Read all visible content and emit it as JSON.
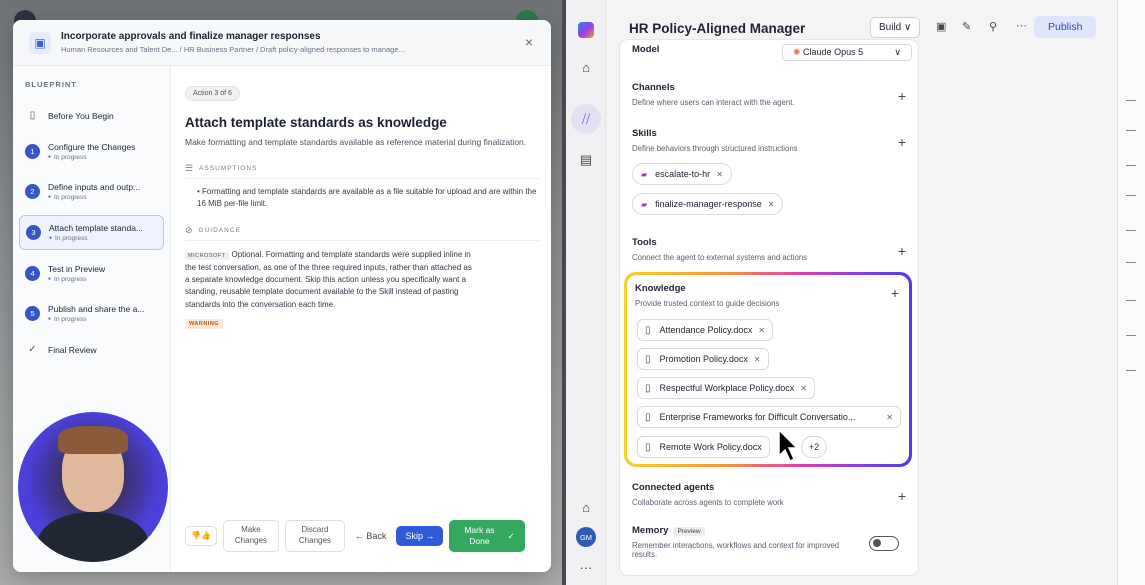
{
  "modal": {
    "title": "Incorporate approvals and finalize manager responses",
    "breadcrumb": "Human Resources and Talent De... / HR Business Partner / Draft policy-aligned responses to manage...",
    "close": "×"
  },
  "sidebar": {
    "label": "BLUEPRINT",
    "before": "Before You Begin",
    "steps": [
      {
        "num": "1",
        "title": "Configure the Changes",
        "status": "In progress"
      },
      {
        "num": "2",
        "title": "Define inputs and outp...",
        "status": "In progress"
      },
      {
        "num": "3",
        "title": "Attach template standa...",
        "status": "In progress"
      },
      {
        "num": "4",
        "title": "Test in Preview",
        "status": "In progress"
      },
      {
        "num": "5",
        "title": "Publish and share the a...",
        "status": "In progress"
      }
    ],
    "final": "Final Review"
  },
  "content": {
    "badge": "Action 3 of 6",
    "title": "Attach template standards as knowledge",
    "desc": "Make formatting and template standards available as reference material during finalization.",
    "assumptions_label": "ASSUMPTIONS",
    "assumption": "Formatting and template standards are available as a file suitable for upload and are within the 16 MiB per-file limit.",
    "guidance_label": "GUIDANCE",
    "ms_tag": "MICROSOFT",
    "guidance": "Optional. Formatting and template standards were supplied inline in the test conversation, as one of the three required inputs, rather than attached as a separate knowledge document. Skip this action unless you specifically want a standing, reusable template document available to the Skill instead of pasting standards into the conversation each time.",
    "warning": "WARNING"
  },
  "footer": {
    "make_changes": "Make Changes",
    "discard_changes": "Discard Changes",
    "back": "← Back",
    "skip": "Skip →",
    "done": "Mark as Done"
  },
  "agent": {
    "title": "HR Policy-Aligned Manager",
    "build": "Build ∨",
    "publish": "Publish",
    "avatar_initials": "GM",
    "model_label": "Model",
    "model_value": "Claude Opus 5",
    "channels": {
      "title": "Channels",
      "desc": "Define where users can interact with the agent."
    },
    "skills": {
      "title": "Skills",
      "desc": "Define behaviors through structured instructions",
      "items": [
        "escalate-to-hr",
        "finalize-manager-response"
      ]
    },
    "tools": {
      "title": "Tools",
      "desc": "Connect the agent to external systems and actions"
    },
    "knowledge": {
      "title": "Knowledge",
      "desc": "Provide trusted context to guide decisions",
      "files": [
        "Attendance Policy.docx",
        "Promotion Policy.docx",
        "Respectful Workplace Policy.docx",
        "Enterprise Frameworks for Difficult Conversatio...",
        "Remote Work Policy.docx"
      ],
      "more": "+2"
    },
    "connected": {
      "title": "Connected agents",
      "desc": "Collaborate across agents to complete work"
    },
    "memory": {
      "title": "Memory",
      "badge": "Preview",
      "desc": "Remember interactions, workflows and context for improved results."
    }
  }
}
